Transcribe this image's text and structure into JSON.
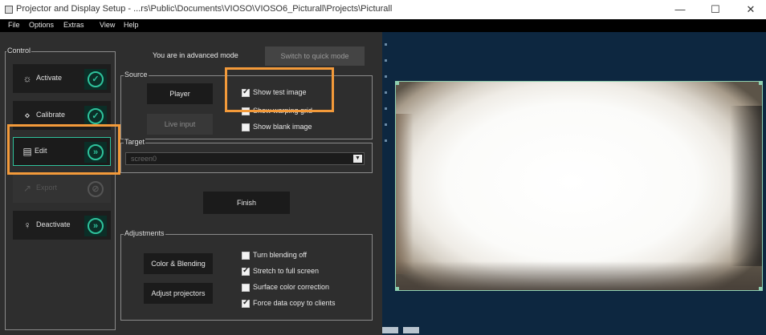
{
  "window": {
    "title": "Projector and Display Setup - ...rs\\Public\\Documents\\VIOSO\\VIOSO6_Picturall\\Projects\\Picturall",
    "minimize": "—",
    "maximize": "☐",
    "close": "✕"
  },
  "menu": [
    "File",
    "Options",
    "Extras",
    "View",
    "Help"
  ],
  "control": {
    "group_label": "Control",
    "steps": [
      {
        "label": "Activate",
        "icon": "bulb-icon",
        "state": "check-icon",
        "enabled": true
      },
      {
        "label": "Calibrate",
        "icon": "calibrate-icon",
        "state": "check-icon",
        "enabled": true
      },
      {
        "label": "Edit",
        "icon": "edit-icon",
        "state": "forward-icon",
        "enabled": true,
        "selected": true
      },
      {
        "label": "Export",
        "icon": "export-icon",
        "state": "blocked-icon",
        "enabled": false
      },
      {
        "label": "Deactivate",
        "icon": "deactivate-icon",
        "state": "forward-icon",
        "enabled": true
      }
    ],
    "glyphs": {
      "check": "✓",
      "forward": "»",
      "blocked": "⊘"
    }
  },
  "mode": {
    "text": "You are in advanced mode",
    "switch_button": "Switch to quick mode"
  },
  "source": {
    "group_label": "Source",
    "player_button": "Player",
    "live_input_button": "Live input",
    "options": [
      {
        "label": "Show test image",
        "checked": true
      },
      {
        "label": "Show warping grid",
        "checked": false
      },
      {
        "label": "Show blank image",
        "checked": false
      }
    ]
  },
  "target": {
    "group_label": "Target",
    "selected_value": "screen0"
  },
  "finish_button": "Finish",
  "adjustments": {
    "group_label": "Adjustments",
    "color_blending_button": "Color & Blending",
    "adjust_projectors_button": "Adjust projectors",
    "options": [
      {
        "label": "Turn blending off",
        "checked": false
      },
      {
        "label": "Stretch to full screen",
        "checked": true
      },
      {
        "label": "Surface color correction",
        "checked": false
      },
      {
        "label": "Force data copy to clients",
        "checked": true
      }
    ]
  },
  "colors": {
    "accent": "#2fc29c",
    "highlight": "#f39a3a",
    "preview_background": "#0d2740"
  }
}
